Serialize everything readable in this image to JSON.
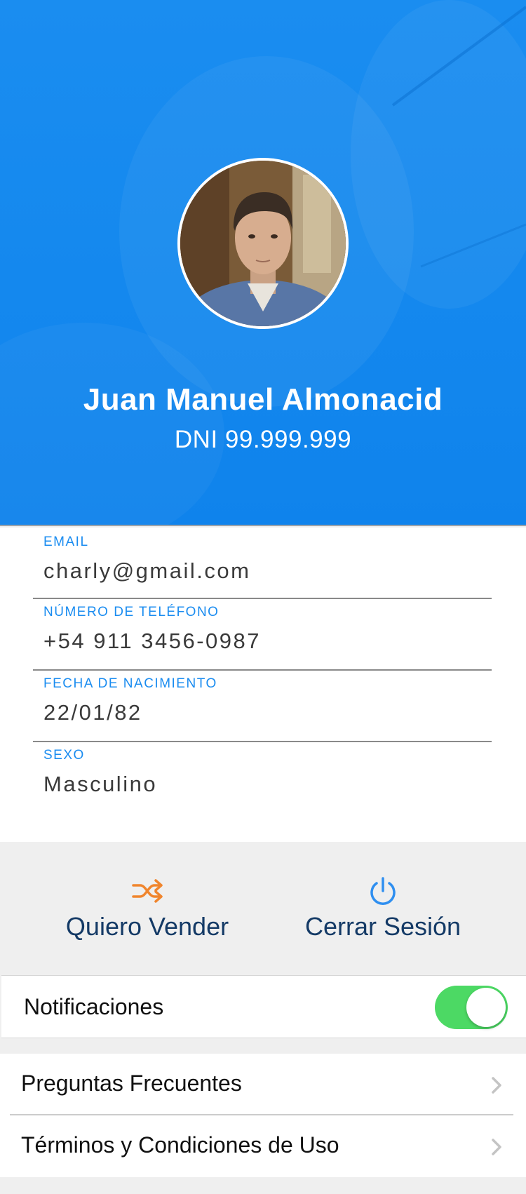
{
  "profile": {
    "name": "Juan Manuel Almonacid",
    "dni": "DNI 99.999.999"
  },
  "fields": [
    {
      "label": "EMAIL",
      "value": "charly@gmail.com"
    },
    {
      "label": "NÚMERO DE TELÉFONO",
      "value": "+54 911 3456-0987"
    },
    {
      "label": "FECHA DE NACIMIENTO",
      "value": "22/01/82"
    },
    {
      "label": "SEXO",
      "value": "Masculino"
    }
  ],
  "actions": {
    "sell": {
      "label": "Quiero Vender",
      "icon": "shuffle-icon",
      "color": "#f0852d"
    },
    "logout": {
      "label": "Cerrar Sesión",
      "icon": "power-icon",
      "color": "#2f8ff0"
    }
  },
  "notifications": {
    "label": "Notificaciones",
    "enabled": true
  },
  "links": [
    {
      "label": "Preguntas Frecuentes"
    },
    {
      "label": "Términos y Condiciones de Uso"
    }
  ],
  "colors": {
    "header_blue": "#1488ee",
    "accent_blue": "#1a8cf0",
    "toggle_green": "#4cd964"
  }
}
